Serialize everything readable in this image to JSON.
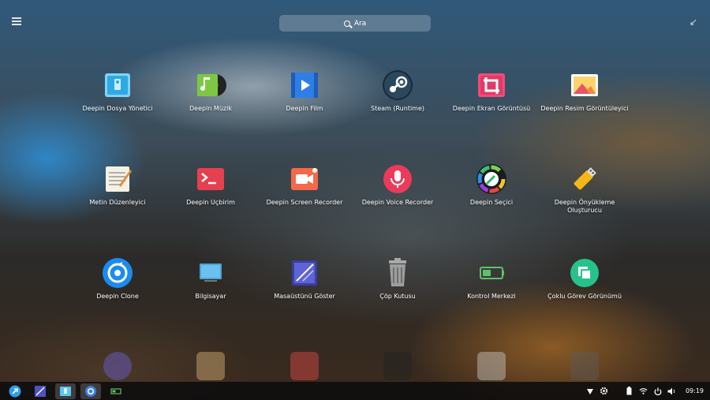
{
  "search": {
    "placeholder": "Ara"
  },
  "apps": [
    {
      "label": "Deepin Dosya Yönetici",
      "icon": "file-manager-icon"
    },
    {
      "label": "Deepin Müzik",
      "icon": "music-icon"
    },
    {
      "label": "Deepin Film",
      "icon": "movie-icon"
    },
    {
      "label": "Steam (Runtime)",
      "icon": "steam-icon"
    },
    {
      "label": "Deepin Ekran Görüntüsü",
      "icon": "screenshot-icon"
    },
    {
      "label": "Deepin Resim Görüntüleyici",
      "icon": "image-viewer-icon"
    },
    {
      "label": "Metin Düzenleyici",
      "icon": "text-editor-icon"
    },
    {
      "label": "Deepin Uçbirim",
      "icon": "terminal-icon"
    },
    {
      "label": "Deepin Screen Recorder",
      "icon": "screen-recorder-icon"
    },
    {
      "label": "Deepin Voice Recorder",
      "icon": "voice-recorder-icon"
    },
    {
      "label": "Deepin Seçici",
      "icon": "color-picker-icon"
    },
    {
      "label": "Deepin Önyükleme Oluşturucu",
      "icon": "boot-maker-icon"
    },
    {
      "label": "Deepin Clone",
      "icon": "clone-icon"
    },
    {
      "label": "Bilgisayar",
      "icon": "computer-icon"
    },
    {
      "label": "Masaüstünü Göster",
      "icon": "show-desktop-icon"
    },
    {
      "label": "Çöp Kutusu",
      "icon": "trash-icon"
    },
    {
      "label": "Kontrol Merkezi",
      "icon": "control-center-icon"
    },
    {
      "label": "Çoklu Görev Görünümü",
      "icon": "multitask-view-icon"
    }
  ],
  "dock": {
    "items": [
      "launcher-icon",
      "show-desktop-icon",
      "file-manager-icon",
      "browser-icon",
      "system-monitor-icon"
    ],
    "clock": "09:19"
  },
  "colors": {
    "dock_bg": "#0c0c0e",
    "search_bg": "rgba(255,255,255,0.22)"
  }
}
